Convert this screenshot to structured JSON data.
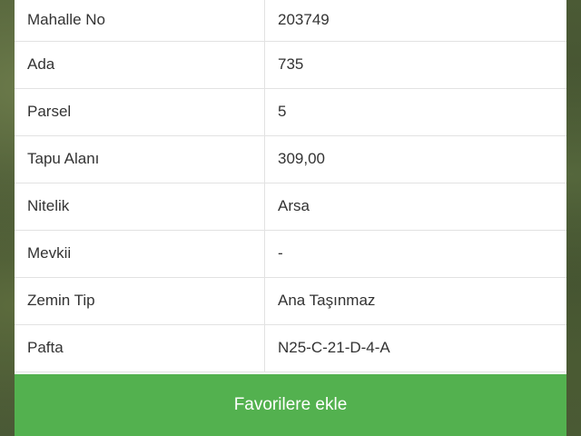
{
  "details": {
    "rows": [
      {
        "key": "Mahalle No",
        "value": "203749"
      },
      {
        "key": "Ada",
        "value": "735"
      },
      {
        "key": "Parsel",
        "value": "5"
      },
      {
        "key": "Tapu Alanı",
        "value": "309,00"
      },
      {
        "key": "Nitelik",
        "value": "Arsa"
      },
      {
        "key": "Mevkii",
        "value": "-"
      },
      {
        "key": "Zemin Tip",
        "value": "Ana Taşınmaz"
      },
      {
        "key": "Pafta",
        "value": "N25-C-21-D-4-A"
      }
    ]
  },
  "actions": {
    "favorite_label": "Favorilere ekle"
  },
  "colors": {
    "accent": "#53b14f",
    "panel_background": "#ffffff",
    "border": "#e2e2e2"
  }
}
